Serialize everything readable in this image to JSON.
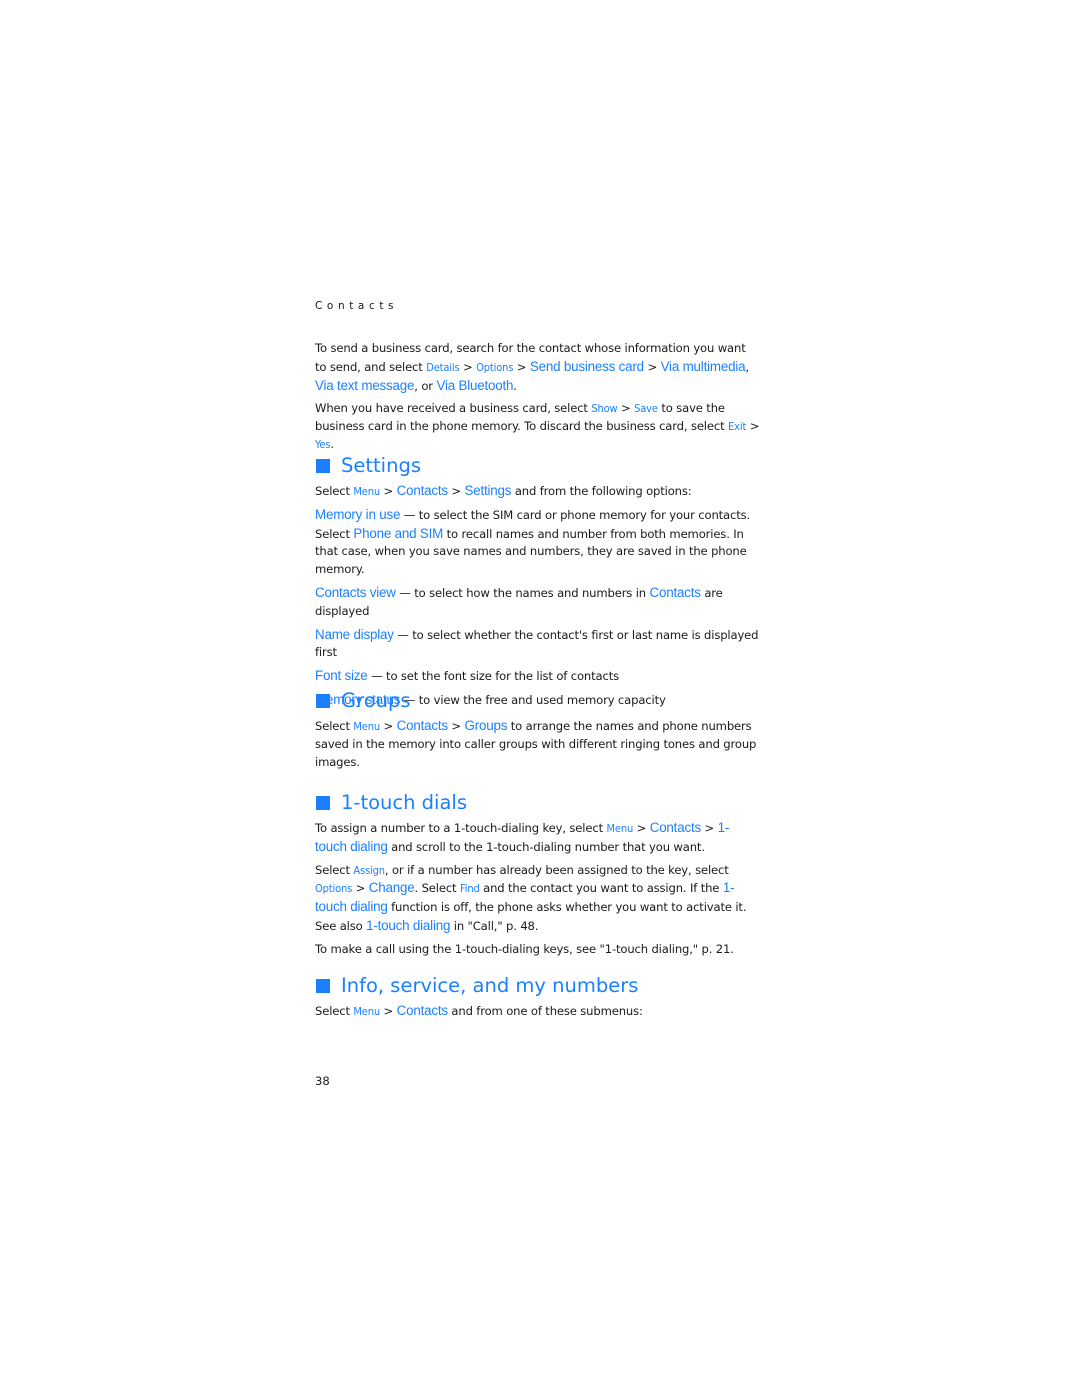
{
  "running_head": "Contacts",
  "page_number": "38",
  "accent_color": "#1a80ff",
  "intro": {
    "p1": {
      "t1": "To send a business card, search for the contact whose information you want to send, and select ",
      "l1": "Details",
      "t2": " > ",
      "l2": "Options",
      "t3": " > ",
      "l3": "Send business card",
      "t4": " > ",
      "l4": "Via multimedia",
      "t5": ", ",
      "l5": "Via text message",
      "t6": ", or ",
      "l6": "Via Bluetooth",
      "t7": "."
    },
    "p2": {
      "t1": "When you have received a business card, select ",
      "l1": "Show",
      "t2": " > ",
      "l2": "Save",
      "t3": " to save the business card in the phone memory. To discard the business card, select ",
      "l3": "Exit",
      "t4": " > ",
      "l4": "Yes",
      "t5": "."
    }
  },
  "settings": {
    "heading": "Settings",
    "intro": {
      "t1": "Select ",
      "l1": "Menu",
      "t2": " > ",
      "l2": "Contacts",
      "t3": " > ",
      "l3": "Settings",
      "t4": " and from the following options:"
    },
    "options": [
      {
        "name": "Memory in use",
        "desc": " — to select the SIM card or phone memory for your contacts. Select ",
        "link2": "Phone and SIM",
        "desc2": " to recall names and number from both memories. In that case, when you save names and numbers, they are saved in the phone memory."
      },
      {
        "name": "Contacts view",
        "desc": " — to select how the names and numbers in ",
        "link2": "Contacts",
        "desc2": " are displayed"
      },
      {
        "name": "Name display",
        "desc": " — to select whether the contact's first or last name is displayed first"
      },
      {
        "name": "Font size",
        "desc": " — to set the font size for the list of contacts"
      },
      {
        "name": "Memory status",
        "desc": " — to view the free and used memory capacity"
      }
    ]
  },
  "groups": {
    "heading": "Groups",
    "p": {
      "t1": "Select ",
      "l1": "Menu",
      "t2": " > ",
      "l2": "Contacts",
      "t3": " > ",
      "l3": "Groups",
      "t4": " to arrange the names and phone numbers saved in the memory into caller groups with different ringing tones and group images."
    }
  },
  "touch_dials": {
    "heading": "1-touch dials",
    "p1": {
      "t1": "To assign a number to a 1-touch-dialing key, select ",
      "l1": "Menu",
      "t2": " > ",
      "l2": "Contacts",
      "t3": " > ",
      "l3": "1-touch dialing",
      "t4": " and scroll to the 1-touch-dialing number that you want."
    },
    "p2": {
      "t1": "Select ",
      "l1": "Assign",
      "t2": ", or if a number has already been assigned to the key, select ",
      "l2": "Options",
      "t3": " > ",
      "l3": "Change",
      "t4": ". Select ",
      "l4": "Find",
      "t5": " and the contact you want to assign. If the ",
      "l5": "1-touch dialing",
      "t6": " function is off, the phone asks whether you want to activate it. See also ",
      "l6": "1-touch dialing",
      "t7": " in \"Call,\" p. 48."
    },
    "p3": "To make a call using the 1-touch-dialing keys, see \"1-touch dialing,\" p. 21."
  },
  "info": {
    "heading": "Info, service, and my numbers",
    "p": {
      "t1": "Select ",
      "l1": "Menu",
      "t2": " > ",
      "l2": "Contacts",
      "t3": " and from one of these submenus:"
    }
  }
}
